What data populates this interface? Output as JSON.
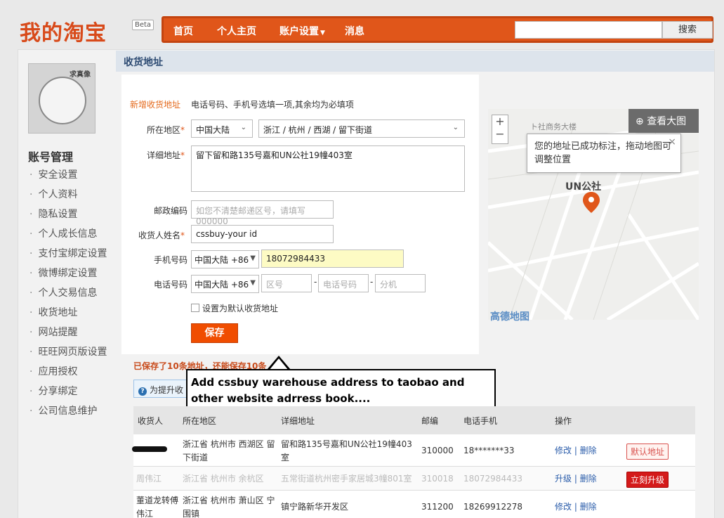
{
  "header": {
    "logo": "我的淘宝",
    "beta": "Beta",
    "nav": [
      "首页",
      "个人主页",
      "账户设置",
      "消息"
    ],
    "search_button": "搜索"
  },
  "sidebar": {
    "avatar_tag": "求真像",
    "title": "账号管理",
    "items": [
      "安全设置",
      "个人资料",
      "隐私设置",
      "个人成长信息",
      "支付宝绑定设置",
      "微博绑定设置",
      "个人交易信息",
      "收货地址",
      "网站提醒",
      "旺旺网页版设置",
      "应用授权",
      "分享绑定",
      "公司信息维护"
    ]
  },
  "page": {
    "title": "收货地址"
  },
  "form": {
    "title": "新增收货地址",
    "note": "电话号码、手机号选填一项,其余均为必填项",
    "region_label": "所在地区",
    "country": "中国大陆",
    "region": "浙江 / 杭州 / 西湖 / 留下街道",
    "address_label": "详细地址",
    "address": "留下留和路135号嘉和UN公社19幢403室",
    "zip_label": "邮政编码",
    "zip_placeholder": "如您不清楚邮递区号，请填写000000",
    "name_label": "收货人姓名",
    "name_value": "cssbuy-your id",
    "mobile_label": "手机号码",
    "mobile_code": "中国大陆 +86",
    "mobile_value": "18072984433",
    "phone_label": "电话号码",
    "phone_code": "中国大陆 +86",
    "area_placeholder": "区号",
    "phone_placeholder": "电话号码",
    "ext_placeholder": "分机",
    "default_label": "设置为默认收货地址",
    "save_label": "保存"
  },
  "map": {
    "enlarge": "查看大图",
    "tip": "您的地址已成功标注，拖动地图可调整位置",
    "label": "UN公社",
    "street": "ト社商务大楼",
    "credit": "高德地图"
  },
  "callout": {
    "text": "Add cssbuy warehouse address to taobao and other website adrress book...."
  },
  "saved_note": "已保存了10条地址，还能保存10条",
  "info_text": "为提升收",
  "table": {
    "headers": [
      "收货人",
      "所在地区",
      "详细地址",
      "邮编",
      "电话手机",
      "操作"
    ],
    "rows": [
      {
        "name": "",
        "region": "浙江省 杭州市 西湖区 留下街道",
        "address": "留和路135号嘉和UN公社19幢403室",
        "zip": "310000",
        "phone": "18*******33",
        "actions": "修改 | 删除",
        "badge": "默认地址"
      },
      {
        "name": "周伟江",
        "region": "浙江省 杭州市 余杭区",
        "address": "五常街道杭州密手家居城3幢801室",
        "zip": "310018",
        "phone": "18072984433",
        "actions": "升级 | 删除",
        "badge": "立刻升级"
      },
      {
        "name": "董道龙转傅伟江",
        "region": "浙江省 杭州市 萧山区 宁围镇",
        "address": "镇宁路新华开发区",
        "zip": "311200",
        "phone": "18269912278",
        "actions": "修改 | 删除",
        "badge": ""
      }
    ]
  },
  "colors": {
    "brand": "#e0561a",
    "accent_blue": "#2a5caa"
  }
}
